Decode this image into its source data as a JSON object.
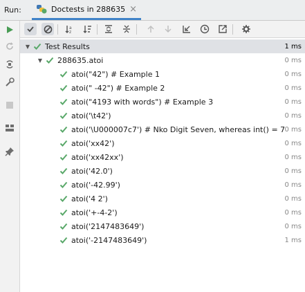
{
  "header": {
    "run_label": "Run:",
    "tab_title": "Doctests in 288635",
    "close_glyph": "×"
  },
  "toolbar": {
    "buttons": [
      "show-passed-icon",
      "show-ignored-icon",
      "sort-alphabetically-icon",
      "sort-by-duration-icon",
      "expand-all-icon",
      "collapse-all-icon",
      "previous-failed-icon",
      "next-failed-icon",
      "import-tests-icon",
      "test-history-icon",
      "export-results-icon",
      "settings-icon"
    ]
  },
  "sidebar": {
    "buttons": [
      "rerun-icon",
      "rerun-failed-icon",
      "toggle-auto-test-icon",
      "settings-wrench-icon",
      "stop-icon",
      "layout-icon",
      "pin-icon"
    ]
  },
  "tree": {
    "root": {
      "label": "Test Results",
      "time": "1 ms"
    },
    "module": {
      "label": "288635.atoi",
      "time": "0 ms"
    },
    "tests": [
      {
        "label": "atoi(\"42\") # Example 1",
        "time": "0 ms"
      },
      {
        "label": "atoi(\"   -42\") # Example 2",
        "time": "0 ms"
      },
      {
        "label": "atoi(\"4193 with words\") # Example 3",
        "time": "0 ms"
      },
      {
        "label": "atoi('\\t42')",
        "time": "0 ms"
      },
      {
        "label": "atoi('\\U000007c7') # Nko Digit Seven, whereas int() = 7",
        "time": "0 ms"
      },
      {
        "label": "atoi('xx42')",
        "time": "0 ms"
      },
      {
        "label": "atoi('xx42xx')",
        "time": "0 ms"
      },
      {
        "label": "atoi('42.0')",
        "time": "0 ms"
      },
      {
        "label": "atoi('-42.99')",
        "time": "0 ms"
      },
      {
        "label": "atoi('4 2')",
        "time": "0 ms"
      },
      {
        "label": "atoi('+-4-2')",
        "time": "0 ms"
      },
      {
        "label": "atoi('2147483649')",
        "time": "0 ms"
      },
      {
        "label": "atoi('-2147483649')",
        "time": "1 ms"
      }
    ]
  },
  "colors": {
    "pass_green": "#59a869",
    "selection": "#dfe1e5",
    "accent": "#4083c9"
  }
}
